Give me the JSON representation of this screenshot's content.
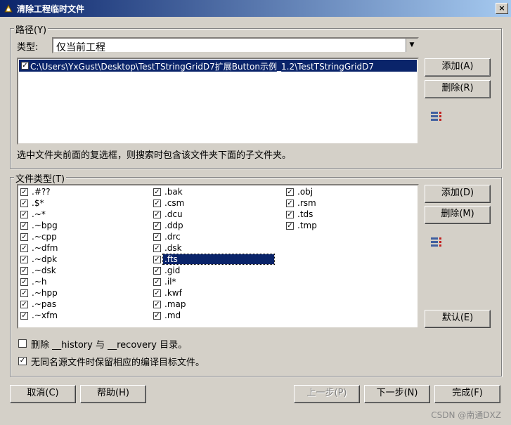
{
  "window": {
    "title": "清除工程临时文件",
    "close_label": "×"
  },
  "path_group": {
    "legend": "路径(Y)",
    "type_label": "类型:",
    "type_value": "仅当前工程",
    "paths": [
      {
        "checked": true,
        "text": "C:\\Users\\YxGust\\Desktop\\TestTStringGridD7扩展Button示例_1.2\\TestTStringGridD7"
      }
    ],
    "hint": "选中文件夹前面的复选框，则搜索时包含该文件夹下面的子文件夹。",
    "add_label": "添加(A)",
    "delete_label": "删除(R)"
  },
  "filetype_group": {
    "legend": "文件类型(T)",
    "columns": [
      [
        ".#??",
        ".$*",
        ".~*",
        ".~bpg",
        ".~cpp",
        ".~dfm",
        ".~dpk",
        ".~dsk",
        ".~h",
        ".~hpp",
        ".~pas",
        ".~xfm"
      ],
      [
        ".bak",
        ".csm",
        ".dcu",
        ".ddp",
        ".drc",
        ".dsk",
        ".fts",
        ".gid",
        ".il*",
        ".kwf",
        ".map",
        ".md"
      ],
      [
        ".obj",
        ".rsm",
        ".tds",
        ".tmp"
      ]
    ],
    "selected": ".fts",
    "add_label": "添加(D)",
    "delete_label": "删除(M)",
    "default_label": "默认(E)"
  },
  "options": {
    "delete_history": {
      "checked": false,
      "label": "删除 __history 与 __recovery 目录。"
    },
    "keep_targets": {
      "checked": true,
      "label": "无同名源文件时保留相应的编译目标文件。"
    }
  },
  "footer": {
    "cancel_label": "取消(C)",
    "help_label": "帮助(H)",
    "prev_label": "上一步(P)",
    "next_label": "下一步(N)",
    "finish_label": "完成(F)"
  },
  "watermark": "CSDN @南通DXZ",
  "colors": {
    "selection": "#0a246a",
    "face": "#d4d0c8"
  },
  "icons": {
    "title": "app-icon",
    "list": "list-edit-icon"
  }
}
